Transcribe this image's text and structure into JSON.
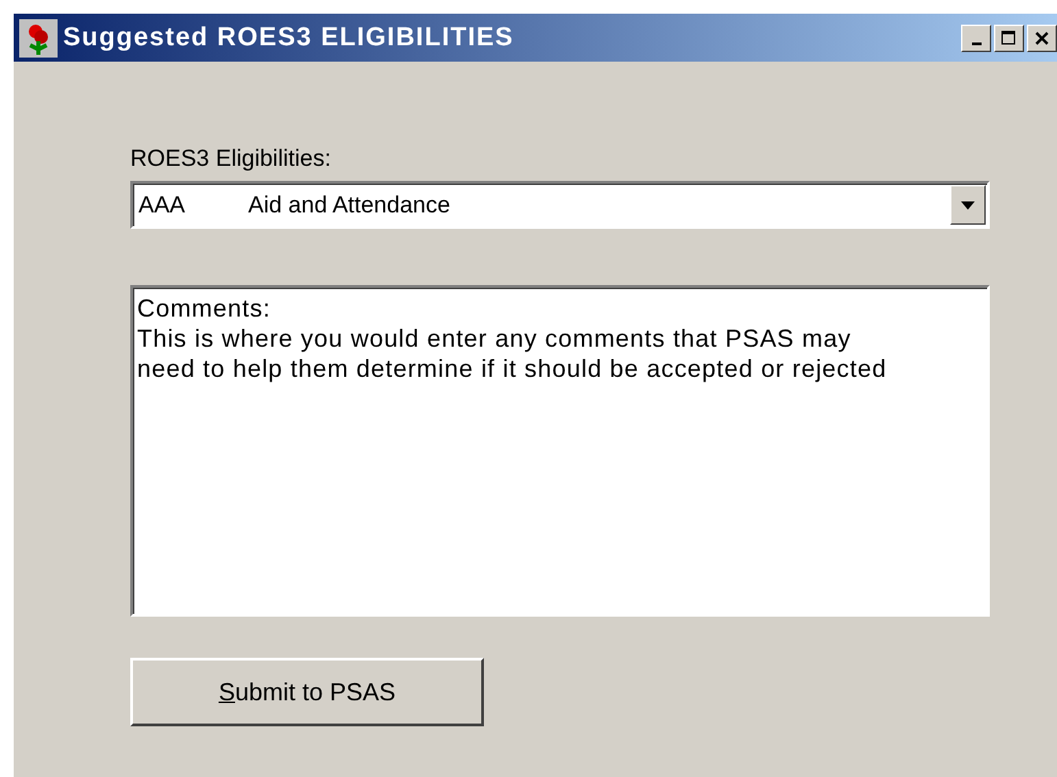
{
  "window": {
    "title": "Suggested ROES3 ELIGIBILITIES"
  },
  "eligibility": {
    "label": "ROES3 Eligibilities:",
    "code": "AAA",
    "value": "Aid and Attendance"
  },
  "comments": {
    "value": "Comments:\nThis is where you would enter any comments that PSAS may\nneed to help them determine if it should be accepted or rejected"
  },
  "submit_button": {
    "mnemonic": "S",
    "rest": "ubmit to PSAS"
  }
}
